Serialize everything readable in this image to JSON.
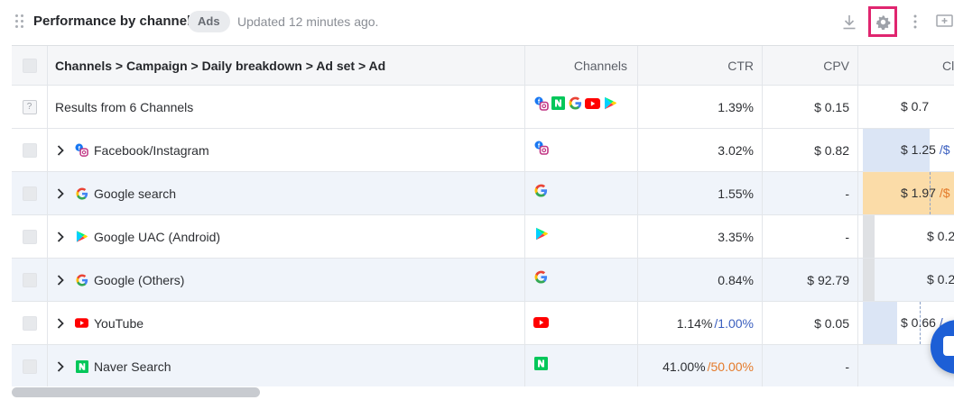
{
  "header": {
    "title": "Performance by channel",
    "badge": "Ads",
    "updated": "Updated 12 minutes ago.",
    "icons": [
      "drag-handle-icon",
      "download-icon",
      "gear-icon",
      "more-vertical-icon",
      "add-panel-icon"
    ]
  },
  "table": {
    "columns": {
      "name": "Channels > Campaign > Daily breakdown > Ad set > Ad",
      "channels": "Channels",
      "ctr": "CTR",
      "cpv": "CPV",
      "cl": "Cl"
    },
    "summary": {
      "label": "Results from 6 Channels",
      "ctr": "1.39%",
      "cpv": "$ 0.15",
      "cl": "$ 0.7",
      "channel_icons": [
        "facebook-instagram-icon",
        "naver-icon",
        "google-icon",
        "youtube-icon",
        "google-play-icon"
      ]
    },
    "rows": [
      {
        "name": "Facebook/Instagram",
        "icon": "facebook-instagram-icon",
        "ctr": "3.02%",
        "ctr_benchmark": "",
        "cpv": "$ 0.82",
        "cl": "$ 1.25",
        "cl_sub": "/$"
      },
      {
        "name": "Google search",
        "icon": "google-icon",
        "ctr": "1.55%",
        "ctr_benchmark": "",
        "cpv": "-",
        "cl": "$ 1.97",
        "cl_sub": "/$"
      },
      {
        "name": "Google UAC (Android)",
        "icon": "google-play-icon",
        "ctr": "3.35%",
        "ctr_benchmark": "",
        "cpv": "-",
        "cl": "$ 0.2",
        "cl_sub": ""
      },
      {
        "name": "Google (Others)",
        "icon": "google-icon",
        "ctr": "0.84%",
        "ctr_benchmark": "",
        "cpv": "$ 92.79",
        "cl": "$ 0.2",
        "cl_sub": ""
      },
      {
        "name": "YouTube",
        "icon": "youtube-icon",
        "ctr": "1.14%",
        "ctr_benchmark": "/1.00%",
        "cpv": "$ 0.05",
        "cl": "$ 0.66",
        "cl_sub": "/"
      },
      {
        "name": "Naver Search",
        "icon": "naver-icon",
        "ctr": "41.00%",
        "ctr_benchmark": "/50.00%",
        "cpv": "-",
        "cl": "",
        "cl_sub": ""
      }
    ]
  },
  "colors": {
    "accent_highlight": "#e0256f",
    "benchmark_good": "#3b5fbf",
    "benchmark_warn": "#e47a2a",
    "row_alt": "#f0f4fa"
  }
}
